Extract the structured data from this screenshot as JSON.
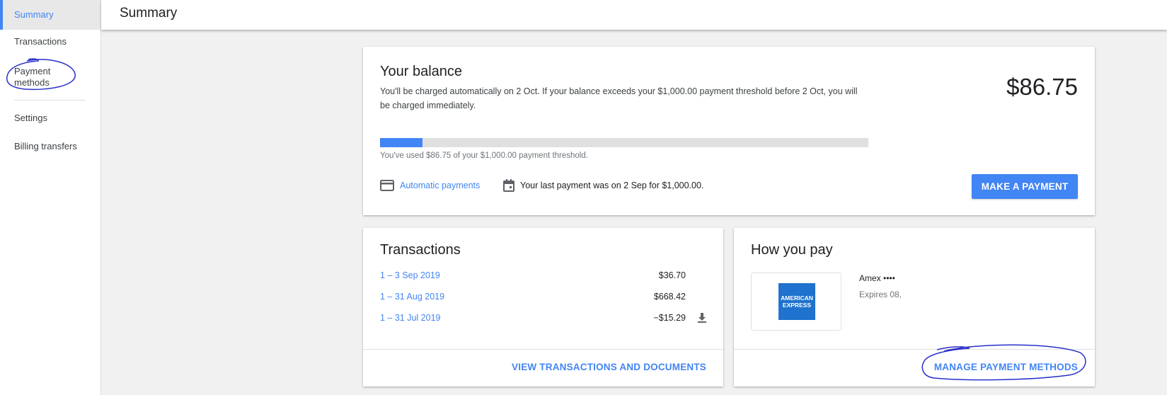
{
  "sidebar": {
    "items": [
      {
        "label": "Summary",
        "active": true
      },
      {
        "label": "Transactions"
      },
      {
        "label": "Payment methods"
      },
      {
        "label": "Settings"
      },
      {
        "label": "Billing transfers"
      }
    ]
  },
  "header": {
    "title": "Summary"
  },
  "balance": {
    "title": "Your balance",
    "description": "You'll be charged automatically on 2 Oct. If your balance exceeds your $1,000.00 payment threshold before 2 Oct, you will be charged immediately.",
    "amount": "$86.75",
    "progress_fraction": 0.08675,
    "progress_caption": "You've used $86.75 of your $1,000.00 payment threshold.",
    "auto_payments_link": "Automatic payments",
    "last_payment": "Your last payment was on 2 Sep for $1,000.00.",
    "make_payment_button": "MAKE A PAYMENT"
  },
  "transactions": {
    "title": "Transactions",
    "rows": [
      {
        "period": "1 – 3 Sep 2019",
        "amount": "$36.70"
      },
      {
        "period": "1 – 31 Aug 2019",
        "amount": "$668.42"
      },
      {
        "period": "1 – 31 Jul 2019",
        "amount": "−$15.29",
        "download": true
      }
    ],
    "footer_link": "VIEW TRANSACTIONS AND DOCUMENTS"
  },
  "how_you_pay": {
    "title": "How you pay",
    "card_name": "Amex ••••",
    "card_expiry": "Expires 08,",
    "logo_text": [
      "AMERICAN",
      "EXPRESS"
    ],
    "footer_link": "MANAGE PAYMENT METHODS"
  },
  "colors": {
    "accent": "#4285f4",
    "annotation": "#2a2fc9",
    "amex_blue": "#1f72cd"
  }
}
